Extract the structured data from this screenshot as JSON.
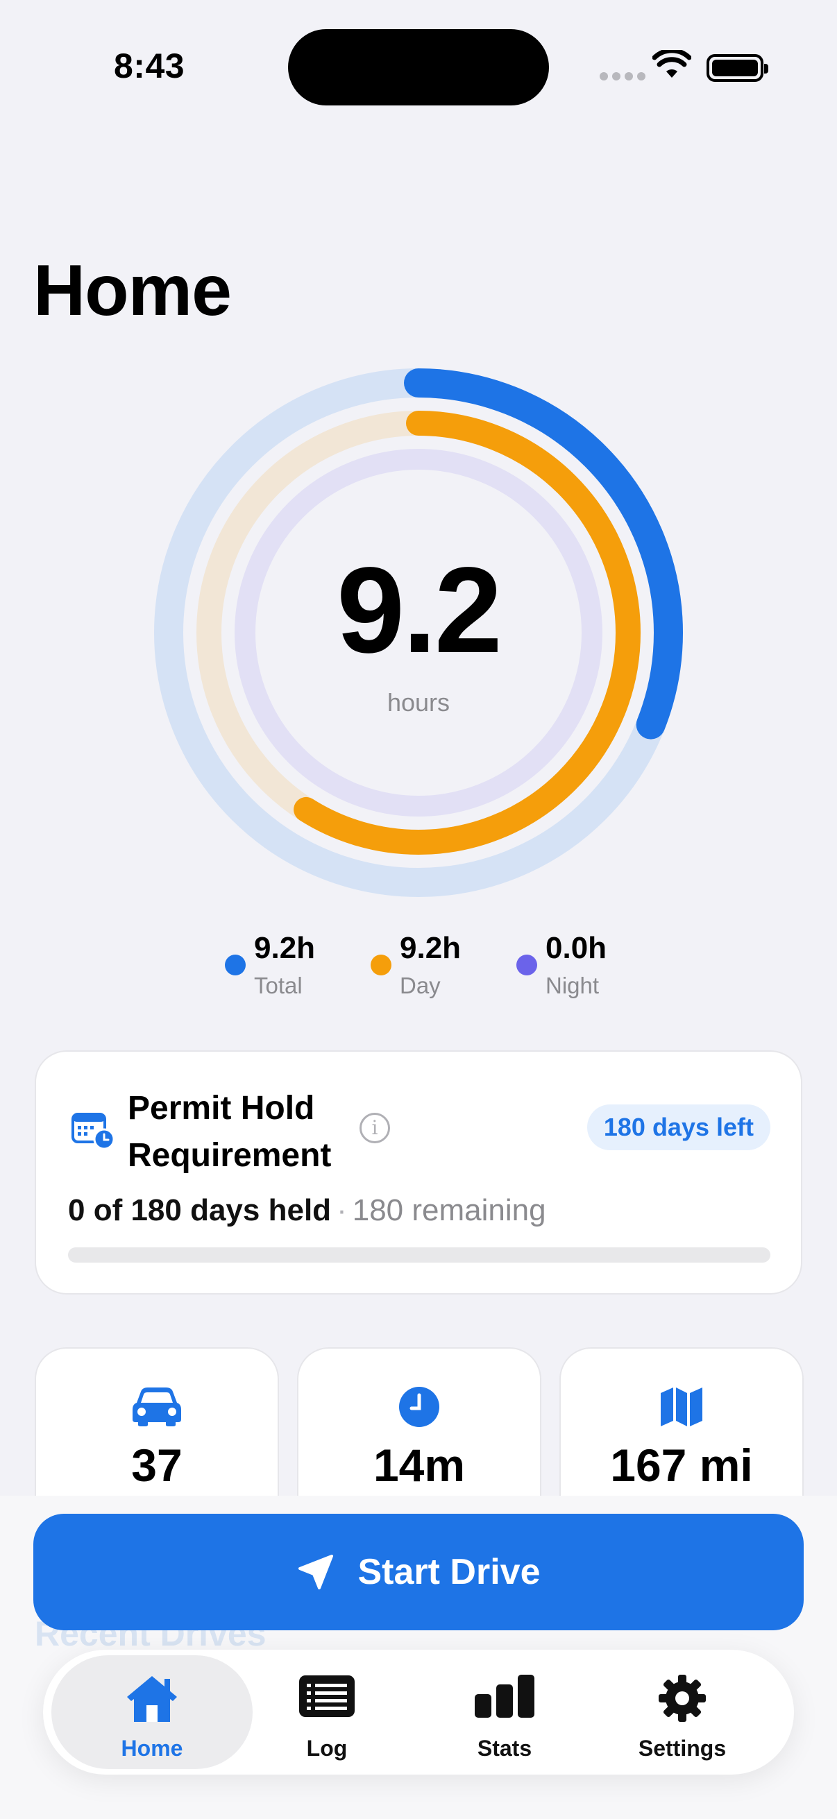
{
  "status_bar": {
    "time": "8:43"
  },
  "page_title": "Home",
  "summary": {
    "hours_value": "9.2",
    "hours_unit": "hours",
    "rings": {
      "total_progress": 0.31,
      "day_progress": 0.59,
      "night_progress": 0.0,
      "colors": {
        "total": "#1e74e6",
        "day": "#f59e0b",
        "night": "#6b63ea"
      }
    },
    "legend": [
      {
        "value": "9.2h",
        "label": "Total",
        "color": "#1e74e6"
      },
      {
        "value": "9.2h",
        "label": "Day",
        "color": "#f59e0b"
      },
      {
        "value": "0.0h",
        "label": "Night",
        "color": "#6b63ea"
      }
    ]
  },
  "permit": {
    "icon": "calendar-clock-icon",
    "title": "Permit Hold Requirement",
    "info_icon_glyph": "i",
    "badge": "180 days left",
    "held_text": "0 of 180 days held",
    "separator": "·",
    "remaining_text": "180 remaining",
    "progress": 0.0
  },
  "stats": [
    {
      "icon": "car-icon",
      "value": "37"
    },
    {
      "icon": "clock-icon",
      "value": "14m"
    },
    {
      "icon": "map-icon",
      "value": "167 mi"
    }
  ],
  "recent_drives_label": "Recent Drives",
  "start_drive_label": "Start Drive",
  "tabs": [
    {
      "label": "Home",
      "icon": "house-icon",
      "active": true
    },
    {
      "label": "Log",
      "icon": "list-icon",
      "active": false
    },
    {
      "label": "Stats",
      "icon": "chart-bars-icon",
      "active": false
    },
    {
      "label": "Settings",
      "icon": "gear-icon",
      "active": false
    }
  ],
  "colors": {
    "accent": "#1e74e6",
    "background": "#f2f2f7"
  }
}
